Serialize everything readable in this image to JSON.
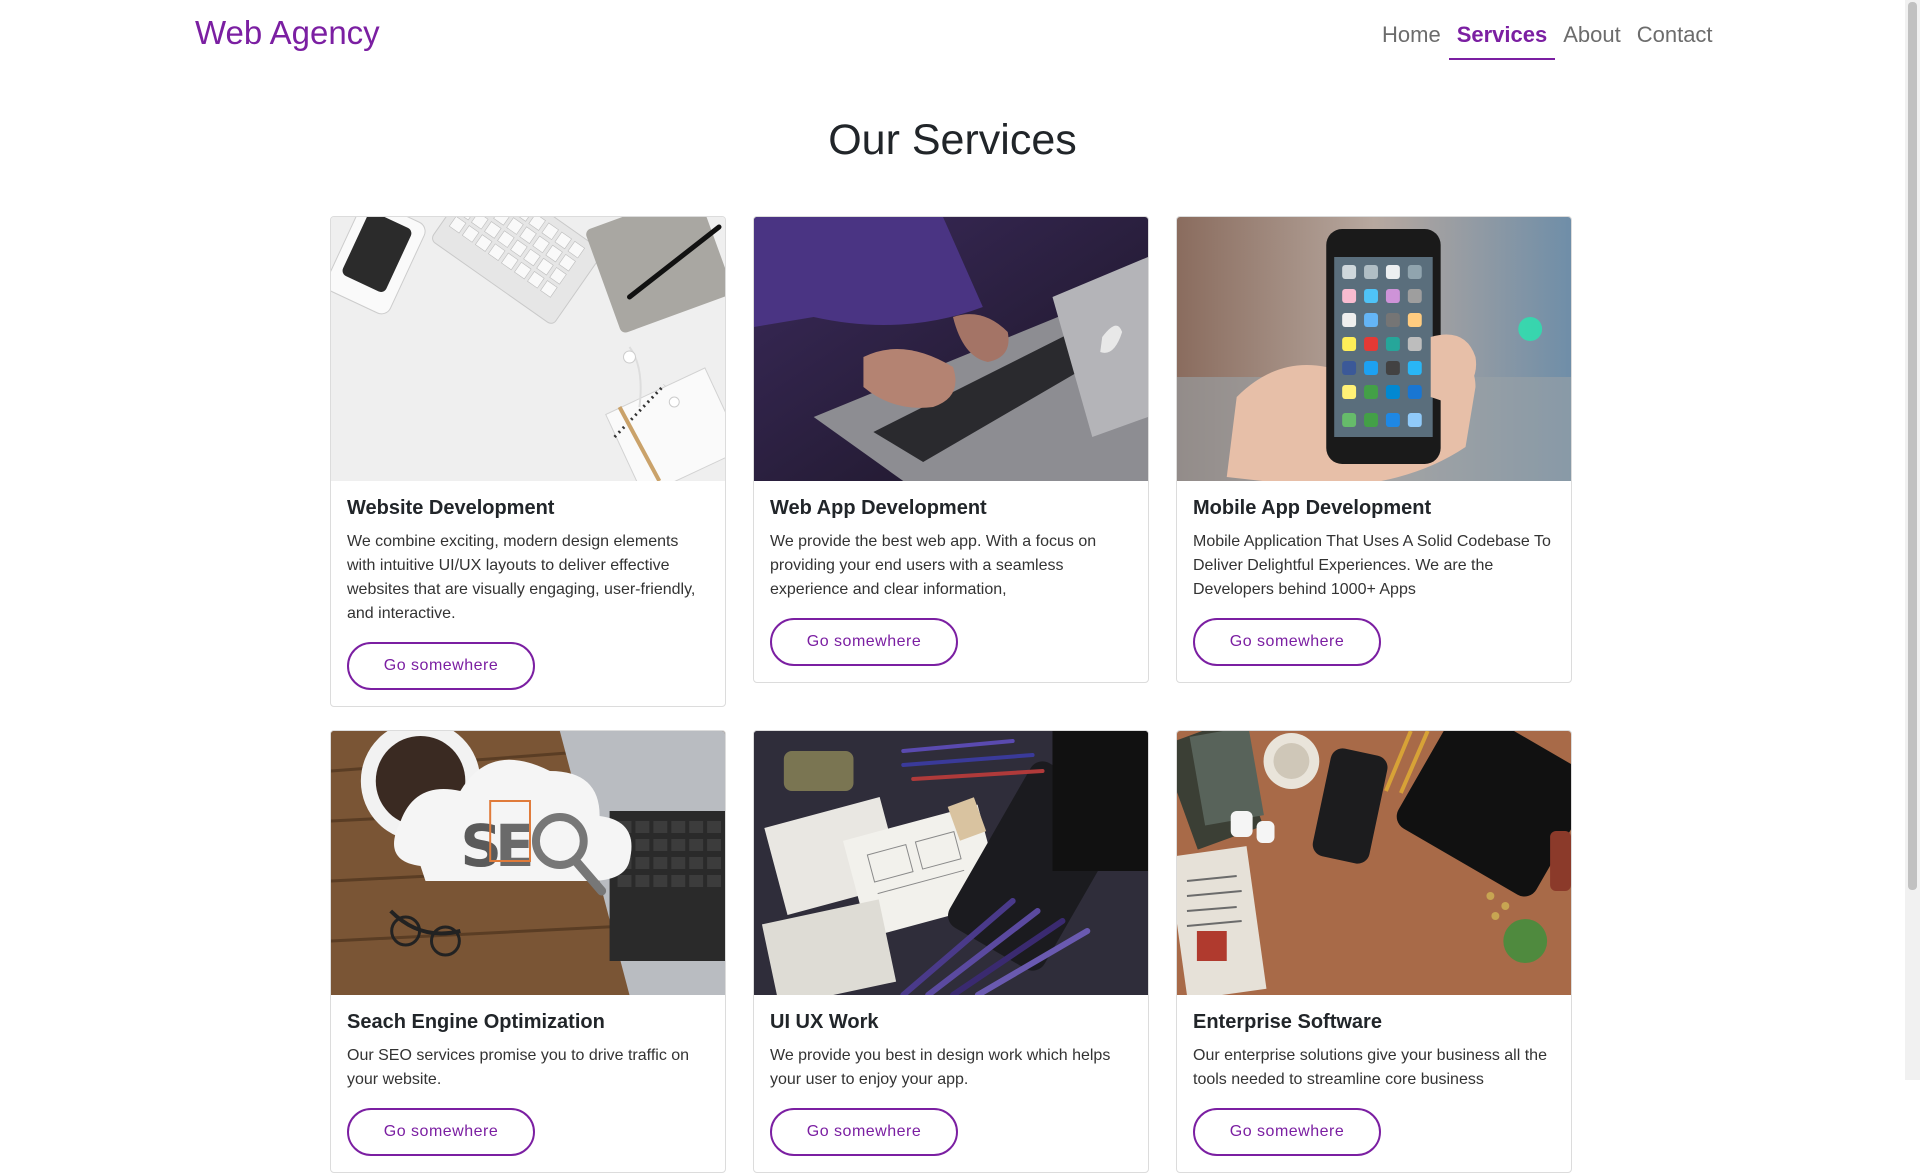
{
  "brand": "Web Agency",
  "nav": {
    "home": "Home",
    "services": "Services",
    "about": "About",
    "contact": "Contact"
  },
  "page_title": "Our Services",
  "cards": [
    {
      "title": "Website Development",
      "text": "We combine exciting, modern design elements with intuitive UI/UX layouts to deliver effective websites that are visually engaging, user-friendly, and interactive.",
      "button": "Go somewhere"
    },
    {
      "title": "Web App Development",
      "text": "We provide the best web app. With a focus on providing your end users with a seamless experience and clear information,",
      "button": "Go somewhere"
    },
    {
      "title": "Mobile App Development",
      "text": "Mobile Application That Uses A Solid Codebase To Deliver Delightful Experiences. We are the Developers behind 1000+ Apps",
      "button": "Go somewhere"
    },
    {
      "title": "Seach Engine Optimization",
      "text": "Our SEO services promise you to drive traffic on your website.",
      "button": "Go somewhere"
    },
    {
      "title": "UI UX Work",
      "text": "We provide you best in design work which helps your user to enjoy your app.",
      "button": "Go somewhere"
    },
    {
      "title": "Enterprise Software",
      "text": "Our enterprise solutions give your business all the tools needed to streamline core business",
      "button": "Go somewhere"
    }
  ],
  "colors": {
    "accent": "#7b1fa2",
    "nav_inactive": "#6c6c6c",
    "text": "#212529"
  }
}
